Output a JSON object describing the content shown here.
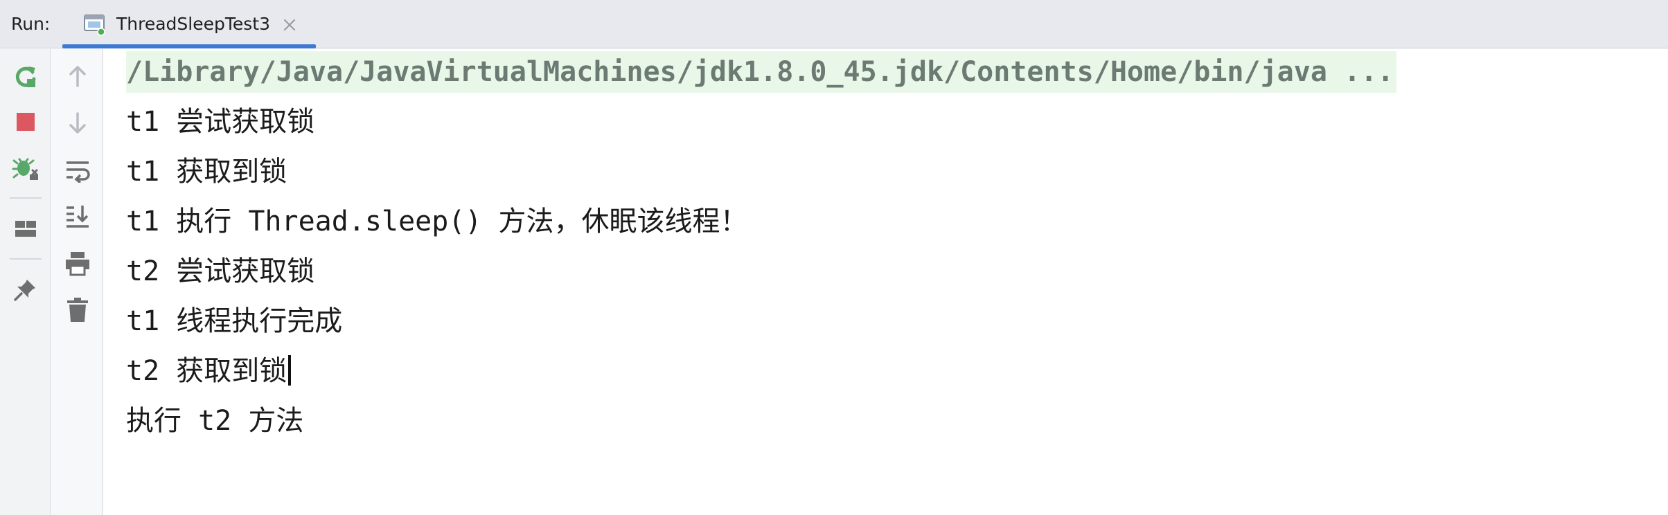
{
  "header": {
    "run_label": "Run:",
    "tab_label": "ThreadSleepTest3"
  },
  "toolbar": {
    "primary": [
      "rerun-icon",
      "stop-icon",
      "debug-rerun-icon",
      "layout-icon",
      "pin-icon"
    ],
    "secondary": [
      "up-arrow-icon",
      "down-arrow-icon",
      "soft-wrap-icon",
      "scroll-to-end-icon",
      "print-icon",
      "trash-icon"
    ]
  },
  "colors": {
    "accent": "#3d7bd3",
    "rerun_green": "#59a869",
    "stop_red": "#db5860",
    "icon_gray": "#6e6e6e",
    "command_bg": "#e9f7e9"
  },
  "console": {
    "command": "/Library/Java/JavaVirtualMachines/jdk1.8.0_45.jdk/Contents/Home/bin/java ...",
    "lines": [
      "t1 尝试获取锁",
      "t1 获取到锁",
      "t1 执行 Thread.sleep() 方法，休眠该线程！",
      "t2 尝试获取锁",
      "t1 线程执行完成",
      "t2 获取到锁",
      "执行 t2 方法"
    ]
  }
}
